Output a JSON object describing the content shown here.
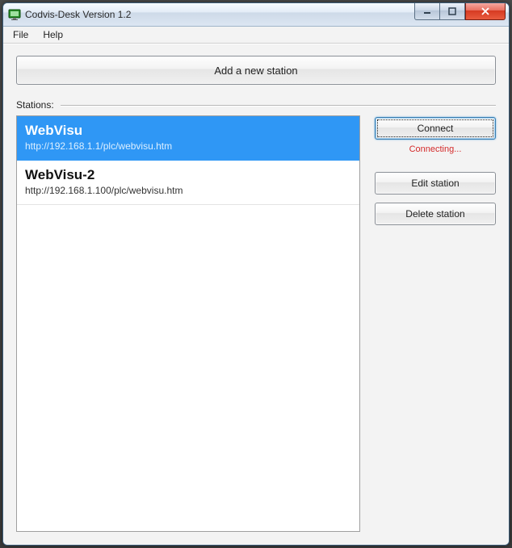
{
  "window": {
    "title": "Codvis-Desk Version 1.2"
  },
  "menu": {
    "file": "File",
    "help": "Help"
  },
  "buttons": {
    "add_station": "Add a new station",
    "connect": "Connect",
    "edit": "Edit station",
    "delete": "Delete station"
  },
  "labels": {
    "stations": "Stations:"
  },
  "status": {
    "connecting": "Connecting..."
  },
  "stations": [
    {
      "name": "WebVisu",
      "url": "http://192.168.1.1/plc/webvisu.htm",
      "selected": true
    },
    {
      "name": "WebVisu-2",
      "url": "http://192.168.1.100/plc/webvisu.htm",
      "selected": false
    }
  ]
}
